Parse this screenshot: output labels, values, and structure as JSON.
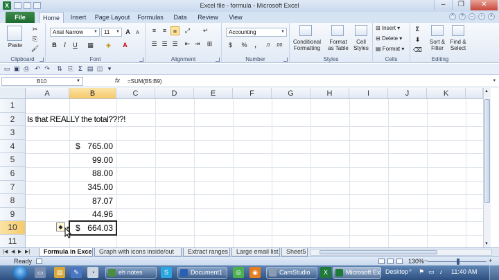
{
  "window": {
    "title": "Excel file - formula  -  Microsoft Excel",
    "app_icon": "X"
  },
  "ribbon_tabs": {
    "file": "File",
    "items": [
      "Home",
      "Insert",
      "Page Layout",
      "Formulas",
      "Data",
      "Review",
      "View"
    ]
  },
  "ribbon": {
    "clipboard": {
      "paste": "Paste",
      "label": "Clipboard"
    },
    "font": {
      "name": "Arial Narrow",
      "size": "11",
      "label": "Font"
    },
    "alignment": {
      "label": "Alignment"
    },
    "number": {
      "format": "Accounting",
      "currency_symbol": "$",
      "percent_symbol": "%",
      "comma_symbol": ",",
      "label": "Number"
    },
    "styles": {
      "conditional_line1": "Conditional",
      "conditional_line2": "Formatting",
      "format_table_line1": "Format",
      "format_table_line2": "as Table",
      "cell_styles_line1": "Cell",
      "cell_styles_line2": "Styles",
      "label": "Styles"
    },
    "cells": {
      "insert": "Insert",
      "delete": "Delete",
      "format": "Format",
      "label": "Cells"
    },
    "editing": {
      "sum_symbol": "Σ",
      "sort_line1": "Sort &",
      "sort_line2": "Filter",
      "find_line1": "Find &",
      "find_line2": "Select",
      "label": "Editing"
    }
  },
  "formula_bar": {
    "name_box": "B10",
    "fx": "fx",
    "formula": "=SUM(B5:B9)"
  },
  "grid": {
    "columns": [
      "A",
      "B",
      "C",
      "D",
      "E",
      "F",
      "G",
      "H",
      "I",
      "J",
      "K"
    ],
    "rows": [
      "1",
      "2",
      "3",
      "4",
      "5",
      "6",
      "7",
      "8",
      "9",
      "10",
      "11"
    ],
    "a2_text": "Is that REALLY the total??!?!",
    "b_values": [
      {
        "row": 4,
        "symbol": "$",
        "value": "765.00"
      },
      {
        "row": 5,
        "symbol": "",
        "value": "99.00"
      },
      {
        "row": 6,
        "symbol": "",
        "value": "88.00"
      },
      {
        "row": 7,
        "symbol": "",
        "value": "345.00"
      },
      {
        "row": 8,
        "symbol": "",
        "value": "87.07"
      },
      {
        "row": 9,
        "symbol": "",
        "value": "44.96"
      },
      {
        "row": 10,
        "symbol": "$",
        "value": "664.03"
      }
    ],
    "selected_cell": "B10"
  },
  "sheets": {
    "tabs": [
      "Formula in Excel",
      "Graph with icons inside/out",
      "Extract ranges",
      "Large email list",
      "Sheet5"
    ],
    "active": 0
  },
  "status": {
    "mode": "Ready",
    "zoom": "130%"
  },
  "taskbar": {
    "buttons": [
      "eh notes",
      "Document1 ...",
      "CamStudio",
      "Microsoft Ex..."
    ],
    "desktop": "Desktop",
    "time": "11:40 AM"
  }
}
